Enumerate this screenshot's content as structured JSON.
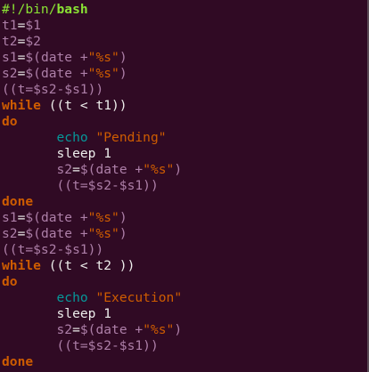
{
  "editor": {
    "lines": [
      [
        {
          "t": "#!/bin/",
          "c": "comment"
        },
        {
          "t": "bash",
          "c": "comment bold"
        }
      ],
      [
        {
          "t": "t1",
          "c": "var"
        },
        {
          "t": "=",
          "c": "plain"
        },
        {
          "t": "$1",
          "c": "var"
        }
      ],
      [
        {
          "t": "t2",
          "c": "var"
        },
        {
          "t": "=",
          "c": "plain"
        },
        {
          "t": "$2",
          "c": "var"
        }
      ],
      [
        {
          "t": "s1",
          "c": "var"
        },
        {
          "t": "=",
          "c": "plain"
        },
        {
          "t": "$(date +",
          "c": "var"
        },
        {
          "t": "\"%s\"",
          "c": "str"
        },
        {
          "t": ")",
          "c": "var"
        }
      ],
      [
        {
          "t": "s2",
          "c": "var"
        },
        {
          "t": "=",
          "c": "plain"
        },
        {
          "t": "$(date +",
          "c": "var"
        },
        {
          "t": "\"%s\"",
          "c": "str"
        },
        {
          "t": ")",
          "c": "var"
        }
      ],
      [
        {
          "t": "((t=$s2-$s1))",
          "c": "var"
        }
      ],
      [
        {
          "t": "while",
          "c": "kw"
        },
        {
          "t": " ((t < t1))",
          "c": "plain"
        }
      ],
      [
        {
          "t": "do",
          "c": "kw"
        }
      ],
      [
        {
          "t": "       ",
          "c": "plain"
        },
        {
          "t": "echo",
          "c": "builtin"
        },
        {
          "t": " ",
          "c": "plain"
        },
        {
          "t": "\"Pending\"",
          "c": "str"
        }
      ],
      [
        {
          "t": "       sleep 1",
          "c": "plain"
        }
      ],
      [
        {
          "t": "       ",
          "c": "plain"
        },
        {
          "t": "s2",
          "c": "var"
        },
        {
          "t": "=",
          "c": "plain"
        },
        {
          "t": "$(date +",
          "c": "var"
        },
        {
          "t": "\"%s\"",
          "c": "str"
        },
        {
          "t": ")",
          "c": "var"
        }
      ],
      [
        {
          "t": "       ",
          "c": "plain"
        },
        {
          "t": "((t=$s2-$s1))",
          "c": "var"
        }
      ],
      [
        {
          "t": "done",
          "c": "kw"
        }
      ],
      [
        {
          "t": "s1",
          "c": "var"
        },
        {
          "t": "=",
          "c": "plain"
        },
        {
          "t": "$(date +",
          "c": "var"
        },
        {
          "t": "\"%s\"",
          "c": "str"
        },
        {
          "t": ")",
          "c": "var"
        }
      ],
      [
        {
          "t": "s2",
          "c": "var"
        },
        {
          "t": "=",
          "c": "plain"
        },
        {
          "t": "$(date +",
          "c": "var"
        },
        {
          "t": "\"%s\"",
          "c": "str"
        },
        {
          "t": ")",
          "c": "var"
        }
      ],
      [
        {
          "t": "((t=$s2-$s1))",
          "c": "var"
        }
      ],
      [
        {
          "t": "while",
          "c": "kw"
        },
        {
          "t": " ((t < t2 ))",
          "c": "plain"
        }
      ],
      [
        {
          "t": "do",
          "c": "kw"
        }
      ],
      [
        {
          "t": "       ",
          "c": "plain"
        },
        {
          "t": "echo",
          "c": "builtin"
        },
        {
          "t": " ",
          "c": "plain"
        },
        {
          "t": "\"Execution\"",
          "c": "str"
        }
      ],
      [
        {
          "t": "       sleep 1",
          "c": "plain"
        }
      ],
      [
        {
          "t": "       ",
          "c": "plain"
        },
        {
          "t": "s2",
          "c": "var"
        },
        {
          "t": "=",
          "c": "plain"
        },
        {
          "t": "$(date +",
          "c": "var"
        },
        {
          "t": "\"%s\"",
          "c": "str"
        },
        {
          "t": ")",
          "c": "var"
        }
      ],
      [
        {
          "t": "       ",
          "c": "plain"
        },
        {
          "t": "((t=$s2-$s1))",
          "c": "var"
        }
      ],
      [
        {
          "t": "done",
          "c": "kw"
        }
      ]
    ]
  }
}
